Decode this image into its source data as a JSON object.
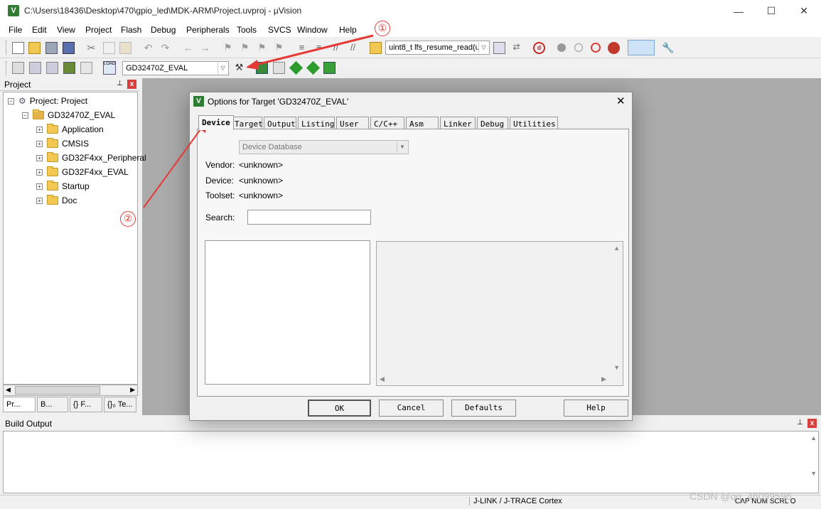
{
  "window": {
    "title": "C:\\Users\\18436\\Desktop\\470\\gpio_led\\MDK-ARM\\Project.uvproj - µVision",
    "icon_letter": "V",
    "minimize": "—",
    "maximize": "☐",
    "close": "✕"
  },
  "menu": [
    "File",
    "Edit",
    "View",
    "Project",
    "Flash",
    "Debug",
    "Peripherals",
    "Tools",
    "SVCS",
    "Window",
    "Help"
  ],
  "toolbar": {
    "function_combo": "uint8_t lfs_resume_read(u",
    "target_combo": "GD32470Z_EVAL"
  },
  "project_panel": {
    "title": "Project",
    "pin": "⊥",
    "close": "x",
    "root": "Project: Project",
    "target": "GD32470Z_EVAL",
    "groups": [
      "Application",
      "CMSIS",
      "GD32F4xx_Peripheral",
      "GD32F4xx_EVAL",
      "Startup",
      "Doc"
    ],
    "tabs": [
      "Pr...",
      "B...",
      "{} F...",
      "{}₀ Te..."
    ]
  },
  "build_output": {
    "title": "Build Output",
    "pin": "⊥",
    "close": "x"
  },
  "statusbar": {
    "debugger": "J-LINK / J-TRACE Cortex",
    "indicators": "CAP  NUM  SCRL  O"
  },
  "dialog": {
    "title": "Options for Target 'GD32470Z_EVAL'",
    "close": "✕",
    "tabs": [
      "Device",
      "Target",
      "Output",
      "Listing",
      "User",
      "C/C++",
      "Asm",
      "Linker",
      "Debug",
      "Utilities"
    ],
    "active_tab": "Device",
    "database_combo": "Device Database",
    "vendor_label": "Vendor:",
    "vendor_value": "<unknown>",
    "device_label": "Device:",
    "device_value": "<unknown>",
    "toolset_label": "Toolset:",
    "toolset_value": "<unknown>",
    "search_label": "Search:",
    "search_value": "",
    "buttons": {
      "ok": "OK",
      "cancel": "Cancel",
      "defaults": "Defaults",
      "help": "Help"
    }
  },
  "annotations": {
    "one": "①",
    "two": "②"
  },
  "watermark": "CSDN @qq_46099596",
  "colors": {
    "accent_red": "#e53935",
    "workspace": "#ababab",
    "app_green": "#2e7d32"
  }
}
